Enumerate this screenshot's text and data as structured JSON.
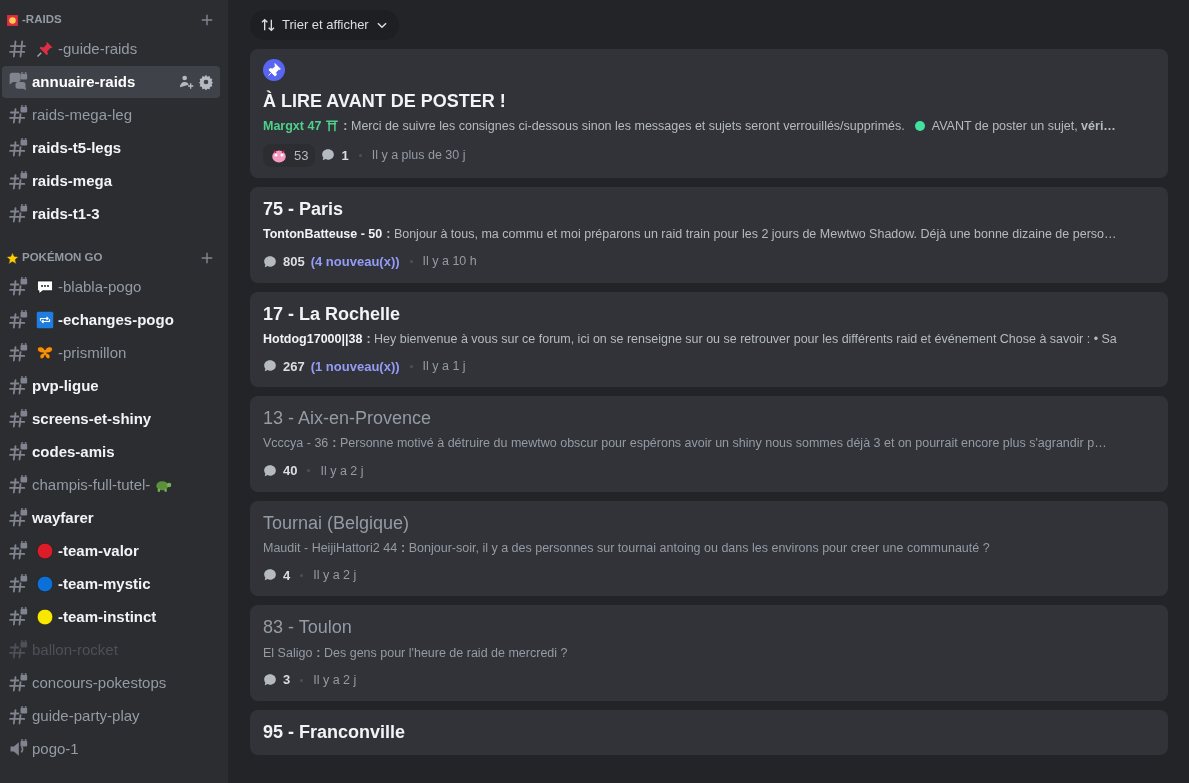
{
  "sidebar": {
    "categories": [
      {
        "name": "-RAIDS",
        "channels": [
          {
            "name": "-guide-raids",
            "kind": "text",
            "emoji": {
              "kind": "pin"
            },
            "unread": false,
            "muted": false,
            "selected": false
          },
          {
            "name": "annuaire-raids",
            "kind": "forum",
            "unread": true,
            "muted": false,
            "selected": true
          },
          {
            "name": "raids-mega-leg",
            "kind": "text-locked",
            "unread": false,
            "muted": false,
            "selected": false
          },
          {
            "name": "raids-t5-legs",
            "kind": "text-locked",
            "unread": true,
            "muted": false,
            "selected": false
          },
          {
            "name": "raids-mega",
            "kind": "text-locked",
            "unread": true,
            "muted": false,
            "selected": false
          },
          {
            "name": "raids-t1-3",
            "kind": "text-locked",
            "unread": true,
            "muted": false,
            "selected": false
          }
        ]
      },
      {
        "name": "POKÉMON GO",
        "channels": [
          {
            "name": "-blabla-pogo",
            "kind": "text-locked",
            "emoji": {
              "kind": "speech"
            },
            "unread": false,
            "muted": false,
            "selected": false
          },
          {
            "name": "-echanges-pogo",
            "kind": "text-locked",
            "emoji": {
              "kind": "repeat"
            },
            "unread": true,
            "muted": false,
            "selected": false
          },
          {
            "name": "-prismillon",
            "kind": "text-locked",
            "emoji": {
              "kind": "butterfly"
            },
            "unread": false,
            "muted": false,
            "selected": false
          },
          {
            "name": "pvp-ligue",
            "kind": "text-locked",
            "unread": true,
            "muted": false,
            "selected": false
          },
          {
            "name": "screens-et-shiny",
            "kind": "text-locked",
            "unread": true,
            "muted": false,
            "selected": false
          },
          {
            "name": "codes-amis",
            "kind": "text-locked",
            "unread": true,
            "muted": false,
            "selected": false
          },
          {
            "name": "champis-full-tutel-",
            "kind": "text-locked",
            "suffix_emoji": {
              "kind": "turtle"
            },
            "unread": false,
            "muted": false,
            "selected": false
          },
          {
            "name": "wayfarer",
            "kind": "text-locked",
            "unread": true,
            "muted": false,
            "selected": false
          },
          {
            "name": "-team-valor",
            "kind": "text-locked",
            "emoji": {
              "kind": "circle",
              "color": "#dd1c2a"
            },
            "unread": true,
            "muted": false,
            "selected": false
          },
          {
            "name": "-team-mystic",
            "kind": "text-locked",
            "emoji": {
              "kind": "circle",
              "color": "#0b70d8"
            },
            "unread": true,
            "muted": false,
            "selected": false
          },
          {
            "name": "-team-instinct",
            "kind": "text-locked",
            "emoji": {
              "kind": "circle",
              "color": "#f8e800"
            },
            "unread": true,
            "muted": false,
            "selected": false
          },
          {
            "name": "ballon-rocket",
            "kind": "text-locked",
            "unread": false,
            "muted": true,
            "selected": false
          },
          {
            "name": "concours-pokestops",
            "kind": "text-locked",
            "unread": false,
            "muted": false,
            "selected": false
          },
          {
            "name": "guide-party-play",
            "kind": "text-locked",
            "unread": false,
            "muted": false,
            "selected": false
          },
          {
            "name": "pogo-1",
            "kind": "voice-locked",
            "unread": false,
            "muted": false,
            "selected": false
          }
        ]
      }
    ]
  },
  "sort_button": {
    "label": "Trier et afficher"
  },
  "posts": [
    {
      "pinned": true,
      "read": false,
      "title": "À LIRE AVANT DE POSTER !",
      "author": "Margxt 47",
      "color": "#4fd18b",
      "author_badge": {
        "kind": "torii"
      },
      "preview": [
        "**:** Merci de suivre les consignes ci-dessous sinon les messages et sujets seront verrouillés/supprimés.",
        "AVANT de poster un sujet, **véri…**"
      ],
      "reaction": "53",
      "replies": "1",
      "time": "Il y a plus de 30 j"
    },
    {
      "pinned": false,
      "read": false,
      "title": "75 - Paris",
      "author": "TontonBatteuse - 50",
      "preview": [
        "**:** Bonjour à tous, ma commu et moi préparons un raid train pour les 2 jours de Mewtwo Shadow. Déjà une bonne dizaine de perso…"
      ],
      "replies": "805",
      "new": "(4 nouveau(x))",
      "time": "Il y a 10 h"
    },
    {
      "pinned": false,
      "read": false,
      "title": "17 - La Rochelle",
      "author": "Hotdog17000||38",
      "preview": [
        "**:** Hey bienvenue à vous sur ce forum, ici on se renseigne sur ou se retrouver pour les différents raid et événement Chose à savoir : • Sa"
      ],
      "replies": "267",
      "new": "(1 nouveau(x))",
      "time": "Il y a 1 j"
    },
    {
      "pinned": false,
      "read": true,
      "title": "13 - Aix-en-Provence",
      "author": "Vcccya - 36",
      "preview": [
        "**:** Personne motivé à détruire du mewtwo obscur pour espérons avoir un shiny nous sommes déjà 3 et on pourrait encore plus s'agrandir p…"
      ],
      "replies": "40",
      "time": "Il y a 2 j"
    },
    {
      "pinned": false,
      "read": true,
      "title": "Tournai (Belgique)",
      "author": "Maudit - HeijiHattori2 44",
      "preview": [
        "**:** Bonjour-soir, il y a des personnes sur tournai antoing ou dans les environs pour creer une communauté ?"
      ],
      "replies": "4",
      "time": "Il y a 2 j"
    },
    {
      "pinned": false,
      "read": true,
      "title": "83 - Toulon",
      "author": "El Saligo",
      "preview": [
        "**:** Des gens pour l'heure de raid de mercredi ?"
      ],
      "replies": "3",
      "time": "Il y a 2 j"
    },
    {
      "pinned": false,
      "read": false,
      "title": "95 - Franconville"
    }
  ]
}
